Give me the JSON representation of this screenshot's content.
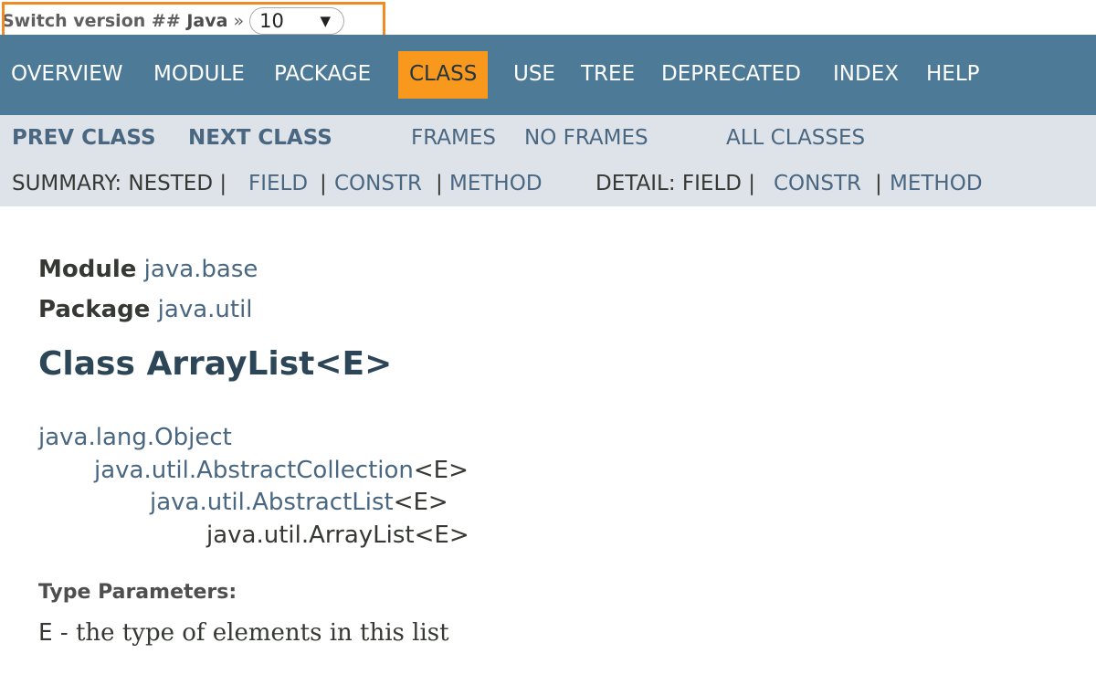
{
  "version_switcher": {
    "label_prefix": "Switch version ## ",
    "label_product": "Java",
    "separator": "»",
    "selected_version": "10",
    "caret": "▼"
  },
  "navbar": {
    "items": [
      "OVERVIEW",
      "MODULE",
      "PACKAGE",
      "CLASS",
      "USE",
      "TREE",
      "DEPRECATED",
      "INDEX",
      "HELP"
    ],
    "active": "CLASS"
  },
  "subnav": {
    "prev_class": "PREV CLASS",
    "next_class": "NEXT CLASS",
    "frames": "FRAMES",
    "no_frames": "NO FRAMES",
    "all_classes": "ALL CLASSES",
    "summary_label": "SUMMARY: NESTED |",
    "summary_field": "FIELD",
    "summary_sep1": "|",
    "summary_constr": "CONSTR",
    "summary_sep2": "|",
    "summary_method": "METHOD",
    "detail_label": "DETAIL: FIELD |",
    "detail_constr": "CONSTR",
    "detail_sep": "|",
    "detail_method": "METHOD"
  },
  "header": {
    "module_label": "Module",
    "module_value": "java.base",
    "package_label": "Package",
    "package_value": "java.util",
    "class_title": "Class ArrayList<E>"
  },
  "hierarchy": [
    {
      "link": "java.lang.Object",
      "suffix": ""
    },
    {
      "link": "java.util.AbstractCollection",
      "suffix": "<E>"
    },
    {
      "link": "java.util.AbstractList",
      "suffix": "<E>"
    },
    {
      "link": "",
      "suffix": "java.util.ArrayList<E>"
    }
  ],
  "type_parameters": {
    "heading": "Type Parameters:",
    "param": "E",
    "description": " - the type of elements in this list"
  },
  "colors": {
    "navbar_bg": "#4d7a97",
    "active_tab_bg": "#f8981d",
    "subnav_bg": "#dee3e9",
    "link": "#4a6782",
    "highlight_border": "#f08a24"
  }
}
